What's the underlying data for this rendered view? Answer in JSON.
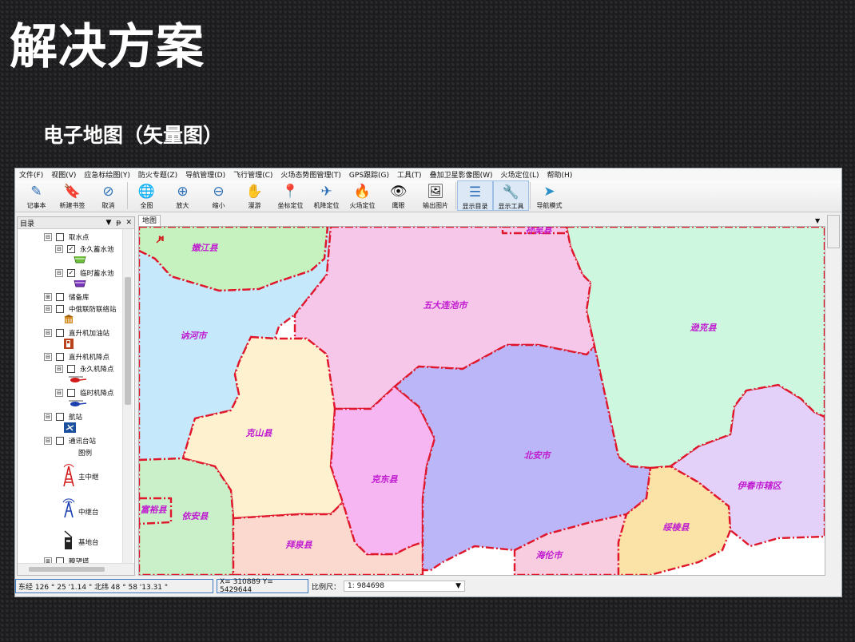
{
  "slide": {
    "title": "解决方案",
    "subtitle": "电子地图（矢量图）"
  },
  "menu": [
    "文件(F)",
    "视图(V)",
    "应急标绘图(Y)",
    "防火专题(Z)",
    "导航管理(D)",
    "飞行管理(C)",
    "火场态势图管理(T)",
    "GPS跟踪(G)",
    "工具(T)",
    "叠加卫星影像图(W)",
    "火场定位(L)",
    "帮助(H)"
  ],
  "toolbar": [
    {
      "label": "记事本",
      "icon": "notepad-icon",
      "glyph": "✎"
    },
    {
      "label": "新建书签",
      "icon": "bookmark-icon",
      "glyph": "🔖"
    },
    {
      "label": "取消",
      "icon": "cancel-icon",
      "glyph": "⊘"
    },
    {
      "label": "全图",
      "icon": "globe-icon",
      "glyph": "🌐"
    },
    {
      "label": "放大",
      "icon": "zoom-in-icon",
      "glyph": "⊕"
    },
    {
      "label": "缩小",
      "icon": "zoom-out-icon",
      "glyph": "⊖"
    },
    {
      "label": "漫游",
      "icon": "pan-hand-icon",
      "glyph": "✋"
    },
    {
      "label": "坐标定位",
      "icon": "pin-icon",
      "glyph": "📍"
    },
    {
      "label": "机降定位",
      "icon": "plane-icon",
      "glyph": "✈"
    },
    {
      "label": "火场定位",
      "icon": "fire-icon",
      "glyph": "🔥"
    },
    {
      "label": "鹰眼",
      "icon": "eagle-eye-icon",
      "glyph": "👁"
    },
    {
      "label": "输出图片",
      "icon": "picture-icon",
      "glyph": "🖼"
    },
    {
      "label": "显示目录",
      "icon": "list-icon",
      "glyph": "☰"
    },
    {
      "label": "显示工具",
      "icon": "wrench-icon",
      "glyph": "🔧"
    },
    {
      "label": "导航模式",
      "icon": "navigation-icon",
      "glyph": "➤"
    }
  ],
  "toc": {
    "title": "目录",
    "pin": "ᵽ",
    "close": "✕",
    "items": [
      {
        "label": "取水点",
        "level": 0,
        "checked": false,
        "expander": "⊟"
      },
      {
        "label": "永久蓄水池",
        "level": 1,
        "checked": true,
        "expander": "⊟",
        "symbol": "water-basin-green-icon"
      },
      {
        "label": "临时蓄水池",
        "level": 1,
        "checked": true,
        "expander": "⊟",
        "symbol": "water-basin-purple-icon"
      },
      {
        "label": "储备库",
        "level": 0,
        "checked": false,
        "expander": "⊞"
      },
      {
        "label": "中俄联防联络站",
        "level": 0,
        "checked": false,
        "expander": "⊟",
        "symbol": "liaison-station-icon"
      },
      {
        "label": "直升机加油站",
        "level": 0,
        "checked": false,
        "expander": "⊟",
        "symbol": "fuel-station-icon"
      },
      {
        "label": "直升机机降点",
        "level": 0,
        "checked": false,
        "expander": "⊟"
      },
      {
        "label": "永久机降点",
        "level": 1,
        "checked": false,
        "expander": "⊟",
        "symbol": "helicopter-red-icon"
      },
      {
        "label": "临时机降点",
        "level": 1,
        "checked": false,
        "expander": "⊟",
        "symbol": "helicopter-blue-icon"
      },
      {
        "label": "航站",
        "level": 0,
        "checked": false,
        "expander": "⊟",
        "symbol": "airport-icon"
      },
      {
        "label": "通讯台站",
        "level": 0,
        "checked": false,
        "expander": "⊟"
      }
    ],
    "legend_title": "图例",
    "legend": [
      {
        "label": "主中继",
        "icon": "main-relay-tower-icon"
      },
      {
        "label": "中继台",
        "icon": "relay-station-icon"
      },
      {
        "label": "基地台",
        "icon": "base-station-icon"
      }
    ],
    "last_item": "瞭望塔"
  },
  "map": {
    "tab": "地图",
    "dropdown": "▼",
    "regions": [
      {
        "name": "嫩江县",
        "color": "#c6f2bf"
      },
      {
        "name": "讷河市",
        "color": "#c5e8fb"
      },
      {
        "name": "五大连池市",
        "color": "#f7c7ea"
      },
      {
        "name": "孙吴县",
        "color": "#f7c7ea"
      },
      {
        "name": "逊克县",
        "color": "#cdf7df"
      },
      {
        "name": "克山县",
        "color": "#fdf1cf"
      },
      {
        "name": "克东县",
        "color": "#f6b6f1"
      },
      {
        "name": "北安市",
        "color": "#bbb6f7"
      },
      {
        "name": "伊春市辖区",
        "color": "#e4d1fa"
      },
      {
        "name": "绥棱县",
        "color": "#fbe3a8"
      },
      {
        "name": "海伦市",
        "color": "#f9cde0"
      },
      {
        "name": "拜泉县",
        "color": "#fbd9cf"
      },
      {
        "name": "依安县",
        "color": "#c9f0c9"
      },
      {
        "name": "富裕县",
        "color": "#c9f0c9"
      }
    ],
    "boundary_color": "#e0162b",
    "label_color": "#c01ad0"
  },
  "status": {
    "lonlat": "东经 126 °  25 '1.14 \"  北纬 48 °  58 '13.31 \"",
    "xy": "X= 310889  Y= 5429644",
    "scale_label": "比例尺：",
    "scale_value": "1:  984698",
    "scale_arrow": "▼"
  }
}
